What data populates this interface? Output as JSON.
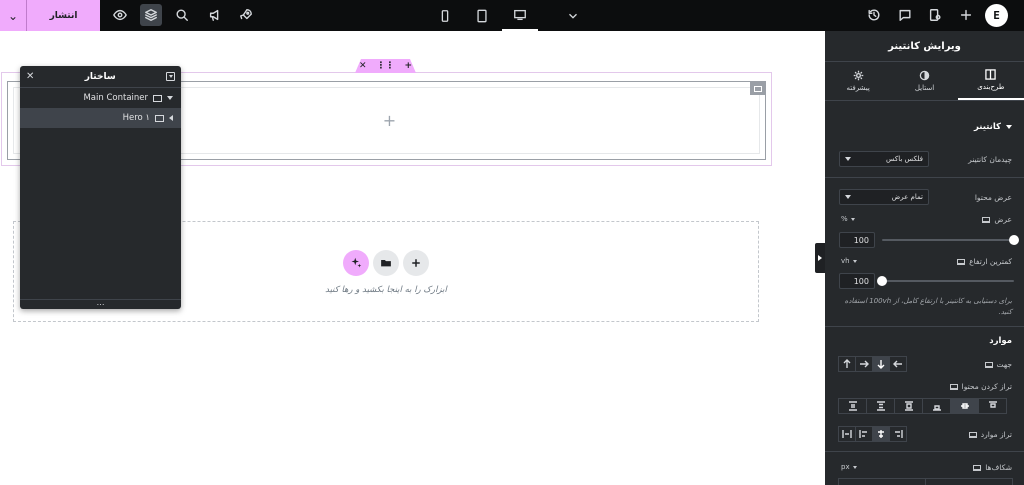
{
  "topbar": {
    "publish_label": "انتشار",
    "logo_letter": "E"
  },
  "canvas": {
    "drop_hint": "ابزارک را به اینجا بکشید و رها کنید"
  },
  "navigator": {
    "title": "ساختار",
    "items": [
      {
        "label": "Main Container"
      },
      {
        "label": "Hero ۱"
      }
    ]
  },
  "panel": {
    "title": "ویرایش کانتینر",
    "tabs": [
      {
        "label": "طرح‌بندی",
        "icon": "layout-icon"
      },
      {
        "label": "استایل",
        "icon": "half-circle-icon"
      },
      {
        "label": "پیشرفته",
        "icon": "gear-icon"
      }
    ],
    "section_container": "کانتینر",
    "container_layout": {
      "label": "چیدمان کانتینر",
      "value": "فلکس باکس"
    },
    "content_width": {
      "label": "عرض محتوا",
      "value": "تمام عرض"
    },
    "width": {
      "label": "عرض",
      "unit": "%",
      "value": "100",
      "fraction": 1.0
    },
    "min_height": {
      "label": "کمترین ارتفاع",
      "unit": "vh",
      "value": "100",
      "fraction": 0.0
    },
    "help_text": "برای دستیابی به کانتینر با ارتفاع کامل، از 100vh استفاده کنید.",
    "section_items": "موارد",
    "direction": {
      "label": "جهت"
    },
    "justify": {
      "label": "تراز کردن محتوا"
    },
    "align": {
      "label": "تراز موارد"
    },
    "gaps": {
      "label": "شکاف‌ها",
      "unit": "px"
    }
  },
  "colors": {
    "accent": "#f0abfc",
    "topbar_bg": "#0c0d0e",
    "panel_bg": "#26292c"
  }
}
